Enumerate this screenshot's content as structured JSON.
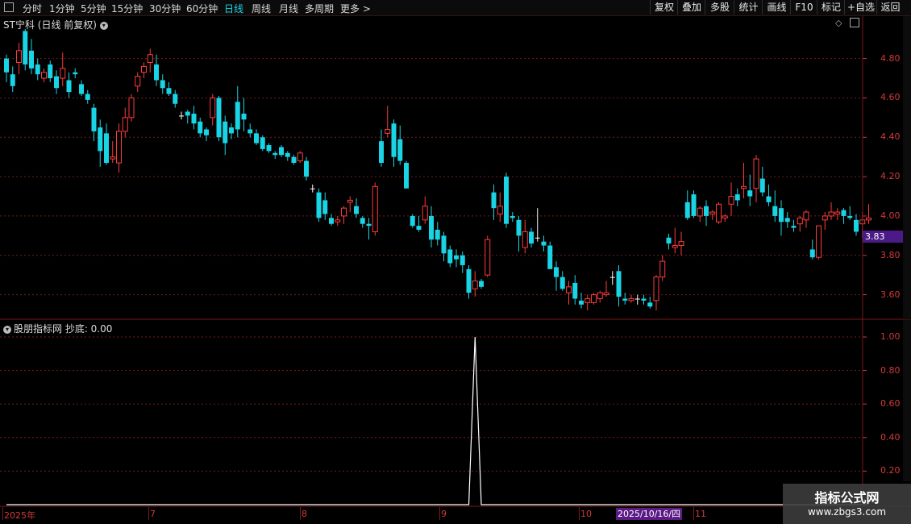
{
  "toolbar": {
    "periods": [
      "分时",
      "1分钟",
      "5分钟",
      "15分钟",
      "30分钟",
      "60分钟",
      "日线",
      "周线",
      "月线",
      "多周期",
      "更多 >"
    ],
    "active_period": "日线",
    "right_buttons": [
      "复权",
      "叠加",
      "多股",
      "统计",
      "画线",
      "F10",
      "标记",
      "+自选",
      "返回"
    ]
  },
  "main_panel": {
    "title": "ST宁科 (日线 前复权)",
    "y_ticks": [
      "4.80",
      "4.60",
      "4.40",
      "4.20",
      "4.00",
      "3.80",
      "3.60"
    ],
    "last_price": "3.83"
  },
  "indicator_panel": {
    "title": "股朋指标网 抄底: 0.00",
    "y_ticks": [
      "1.00",
      "0.80",
      "0.60",
      "0.40",
      "0.20"
    ]
  },
  "x_axis": {
    "labels": [
      "2025年",
      "7",
      "8",
      "9",
      "10",
      "11"
    ],
    "cursor_date": "2025/10/16/四"
  },
  "watermark": {
    "line1": "指标公式网",
    "line2": "www.zbgs3.com"
  },
  "colors": {
    "up": "#ff3b3b",
    "down": "#19d4e4",
    "grid": "#7a1a1a",
    "axis": "#d23a3a",
    "flat": "#ffffff"
  },
  "chart_data": [
    {
      "type": "candlestick",
      "title": "ST宁科 (日线 前复权)",
      "ylim": [
        3.5,
        4.95
      ],
      "x_labels": [
        "2025年",
        "7",
        "8",
        "9",
        "10",
        "11"
      ],
      "series": [
        {
          "name": "",
          "ohlc": [
            [
              4.8,
              4.82,
              4.68,
              4.73
            ],
            [
              4.72,
              4.76,
              4.63,
              4.66
            ],
            [
              4.78,
              4.88,
              4.72,
              4.84
            ],
            [
              4.94,
              4.95,
              4.74,
              4.77
            ],
            [
              4.84,
              4.9,
              4.72,
              4.75
            ],
            [
              4.77,
              4.8,
              4.69,
              4.72
            ],
            [
              4.7,
              4.75,
              4.68,
              4.73
            ],
            [
              4.77,
              4.79,
              4.68,
              4.7
            ],
            [
              4.71,
              4.74,
              4.62,
              4.65
            ],
            [
              4.7,
              4.83,
              4.66,
              4.75
            ],
            [
              4.69,
              4.73,
              4.6,
              4.63
            ],
            [
              4.73,
              4.75,
              4.7,
              4.72
            ],
            [
              4.67,
              4.69,
              4.61,
              4.62
            ],
            [
              4.62,
              4.64,
              4.57,
              4.59
            ],
            [
              4.55,
              4.57,
              4.38,
              4.43
            ],
            [
              4.45,
              4.49,
              4.25,
              4.33
            ],
            [
              4.42,
              4.47,
              4.26,
              4.27
            ],
            [
              4.29,
              4.38,
              4.27,
              4.3
            ],
            [
              4.27,
              4.47,
              4.22,
              4.43
            ],
            [
              4.43,
              4.55,
              4.4,
              4.5
            ],
            [
              4.5,
              4.62,
              4.48,
              4.6
            ],
            [
              4.66,
              4.73,
              4.63,
              4.71
            ],
            [
              4.73,
              4.78,
              4.7,
              4.76
            ],
            [
              4.78,
              4.85,
              4.73,
              4.82
            ],
            [
              4.77,
              4.82,
              4.66,
              4.69
            ],
            [
              4.69,
              4.72,
              4.62,
              4.65
            ],
            [
              4.65,
              4.68,
              4.61,
              4.62
            ],
            [
              4.62,
              4.64,
              4.55,
              4.57
            ],
            [
              4.51,
              4.53,
              4.49,
              4.51
            ],
            [
              4.53,
              4.54,
              4.47,
              4.51
            ],
            [
              4.52,
              4.56,
              4.44,
              4.47
            ],
            [
              4.48,
              4.5,
              4.4,
              4.42
            ],
            [
              4.44,
              4.45,
              4.38,
              4.41
            ],
            [
              4.5,
              4.62,
              4.46,
              4.6
            ],
            [
              4.6,
              4.61,
              4.38,
              4.4
            ],
            [
              4.48,
              4.51,
              4.31,
              4.37
            ],
            [
              4.45,
              4.47,
              4.39,
              4.42
            ],
            [
              4.58,
              4.66,
              4.4,
              4.44
            ],
            [
              4.52,
              4.6,
              4.43,
              4.49
            ],
            [
              4.44,
              4.47,
              4.4,
              4.42
            ],
            [
              4.42,
              4.44,
              4.36,
              4.37
            ],
            [
              4.4,
              4.41,
              4.33,
              4.34
            ],
            [
              4.36,
              4.37,
              4.32,
              4.33
            ],
            [
              4.32,
              4.33,
              4.29,
              4.31
            ],
            [
              4.35,
              4.36,
              4.3,
              4.31
            ],
            [
              4.32,
              4.33,
              4.28,
              4.3
            ],
            [
              4.3,
              4.31,
              4.26,
              4.27
            ],
            [
              4.28,
              4.33,
              4.27,
              4.32
            ],
            [
              4.28,
              4.3,
              4.18,
              4.2
            ],
            [
              4.14,
              4.16,
              4.12,
              4.14
            ],
            [
              4.12,
              4.14,
              3.97,
              3.99
            ],
            [
              4.08,
              4.12,
              3.98,
              4.01
            ],
            [
              3.99,
              4.01,
              3.95,
              3.96
            ],
            [
              3.97,
              4.0,
              3.95,
              3.98
            ],
            [
              4.0,
              4.05,
              3.96,
              4.04
            ],
            [
              4.07,
              4.1,
              4.02,
              4.08
            ],
            [
              4.05,
              4.09,
              3.99,
              4.01
            ],
            [
              3.99,
              4.0,
              3.94,
              3.96
            ],
            [
              3.96,
              3.99,
              3.88,
              3.95
            ],
            [
              3.92,
              4.17,
              3.9,
              4.15
            ],
            [
              4.38,
              4.44,
              4.25,
              4.27
            ],
            [
              4.42,
              4.56,
              4.4,
              4.44
            ],
            [
              4.47,
              4.49,
              4.25,
              4.3
            ],
            [
              4.39,
              4.46,
              4.26,
              4.28
            ],
            [
              4.27,
              4.28,
              4.15,
              4.14
            ],
            [
              4.0,
              4.01,
              3.94,
              3.95
            ],
            [
              3.95,
              4.0,
              3.92,
              3.93
            ],
            [
              3.98,
              4.1,
              3.96,
              4.05
            ],
            [
              4.0,
              4.05,
              3.84,
              3.88
            ],
            [
              3.93,
              3.97,
              3.85,
              3.88
            ],
            [
              3.9,
              3.92,
              3.77,
              3.81
            ],
            [
              3.83,
              3.85,
              3.74,
              3.76
            ],
            [
              3.8,
              3.83,
              3.74,
              3.78
            ],
            [
              3.8,
              3.82,
              3.71,
              3.75
            ],
            [
              3.73,
              3.75,
              3.58,
              3.61
            ],
            [
              3.63,
              3.72,
              3.59,
              3.67
            ],
            [
              3.67,
              3.68,
              3.63,
              3.64
            ],
            [
              3.7,
              3.9,
              3.69,
              3.88
            ],
            [
              4.12,
              4.16,
              3.98,
              4.04
            ],
            [
              4.01,
              4.12,
              3.97,
              4.05
            ],
            [
              4.2,
              4.22,
              3.94,
              3.96
            ],
            [
              4.0,
              4.02,
              3.97,
              3.99
            ],
            [
              3.98,
              4.0,
              3.82,
              3.9
            ],
            [
              3.84,
              3.98,
              3.81,
              3.92
            ],
            [
              3.92,
              3.94,
              3.84,
              3.86
            ],
            [
              3.89,
              4.04,
              3.87,
              3.89
            ],
            [
              3.87,
              3.9,
              3.82,
              3.85
            ],
            [
              3.85,
              3.87,
              3.75,
              3.73
            ],
            [
              3.74,
              3.77,
              3.62,
              3.69
            ],
            [
              3.69,
              3.72,
              3.62,
              3.63
            ],
            [
              3.61,
              3.67,
              3.55,
              3.64
            ],
            [
              3.66,
              3.7,
              3.55,
              3.58
            ],
            [
              3.57,
              3.61,
              3.53,
              3.55
            ],
            [
              3.56,
              3.6,
              3.52,
              3.58
            ],
            [
              3.56,
              3.61,
              3.55,
              3.6
            ],
            [
              3.58,
              3.62,
              3.56,
              3.61
            ],
            [
              3.6,
              3.67,
              3.59,
              3.61
            ],
            [
              3.69,
              3.72,
              3.65,
              3.69
            ],
            [
              3.72,
              3.75,
              3.54,
              3.59
            ],
            [
              3.58,
              3.61,
              3.55,
              3.57
            ],
            [
              3.57,
              3.6,
              3.56,
              3.58
            ],
            [
              3.58,
              3.6,
              3.55,
              3.58
            ],
            [
              3.58,
              3.6,
              3.55,
              3.57
            ],
            [
              3.56,
              3.59,
              3.53,
              3.54
            ],
            [
              3.57,
              3.7,
              3.52,
              3.69
            ],
            [
              3.69,
              3.8,
              3.67,
              3.77
            ],
            [
              3.89,
              3.91,
              3.83,
              3.86
            ],
            [
              3.84,
              3.94,
              3.81,
              3.85
            ],
            [
              3.85,
              3.92,
              3.8,
              3.87
            ],
            [
              4.07,
              4.13,
              3.98,
              3.99
            ],
            [
              4.11,
              4.13,
              3.99,
              4.0
            ],
            [
              4.0,
              4.05,
              3.97,
              4.04
            ],
            [
              4.05,
              4.08,
              3.95,
              4.0
            ],
            [
              4.01,
              4.03,
              3.98,
              4.02
            ],
            [
              3.97,
              4.07,
              3.96,
              4.06
            ],
            [
              3.99,
              4.01,
              3.97,
              4.0
            ],
            [
              4.06,
              4.17,
              4.0,
              4.1
            ],
            [
              4.11,
              4.14,
              4.05,
              4.08
            ],
            [
              4.14,
              4.27,
              4.09,
              4.15
            ],
            [
              4.13,
              4.21,
              4.05,
              4.1
            ],
            [
              4.14,
              4.31,
              4.07,
              4.29
            ],
            [
              4.19,
              4.25,
              4.1,
              4.12
            ],
            [
              4.1,
              4.16,
              4.05,
              4.07
            ],
            [
              4.05,
              4.13,
              3.97,
              4.0
            ],
            [
              4.04,
              4.08,
              3.9,
              3.97
            ],
            [
              3.99,
              4.02,
              3.94,
              3.97
            ],
            [
              3.95,
              3.98,
              3.92,
              3.94
            ],
            [
              3.96,
              4.0,
              3.92,
              3.99
            ],
            [
              3.98,
              4.03,
              3.94,
              4.02
            ],
            [
              3.83,
              3.88,
              3.78,
              3.79
            ],
            [
              3.79,
              3.95,
              3.78,
              3.95
            ],
            [
              3.98,
              4.02,
              3.93,
              4.0
            ],
            [
              4.0,
              4.07,
              3.98,
              4.02
            ],
            [
              4.01,
              4.04,
              3.98,
              4.02
            ],
            [
              4.03,
              4.04,
              3.96,
              4.0
            ],
            [
              4.0,
              4.05,
              3.98,
              3.99
            ],
            [
              3.98,
              4.01,
              3.9,
              3.92
            ],
            [
              3.96,
              4.02,
              3.89,
              3.98
            ],
            [
              3.98,
              4.06,
              3.96,
              3.99
            ]
          ]
        }
      ]
    },
    {
      "type": "line",
      "title": "股朋指标网 抄底: 0.00",
      "ylim": [
        0,
        1.05
      ],
      "series": [
        {
          "name": "抄底",
          "pulse_index": 75,
          "values_note_peak": 1.0
        }
      ]
    }
  ]
}
